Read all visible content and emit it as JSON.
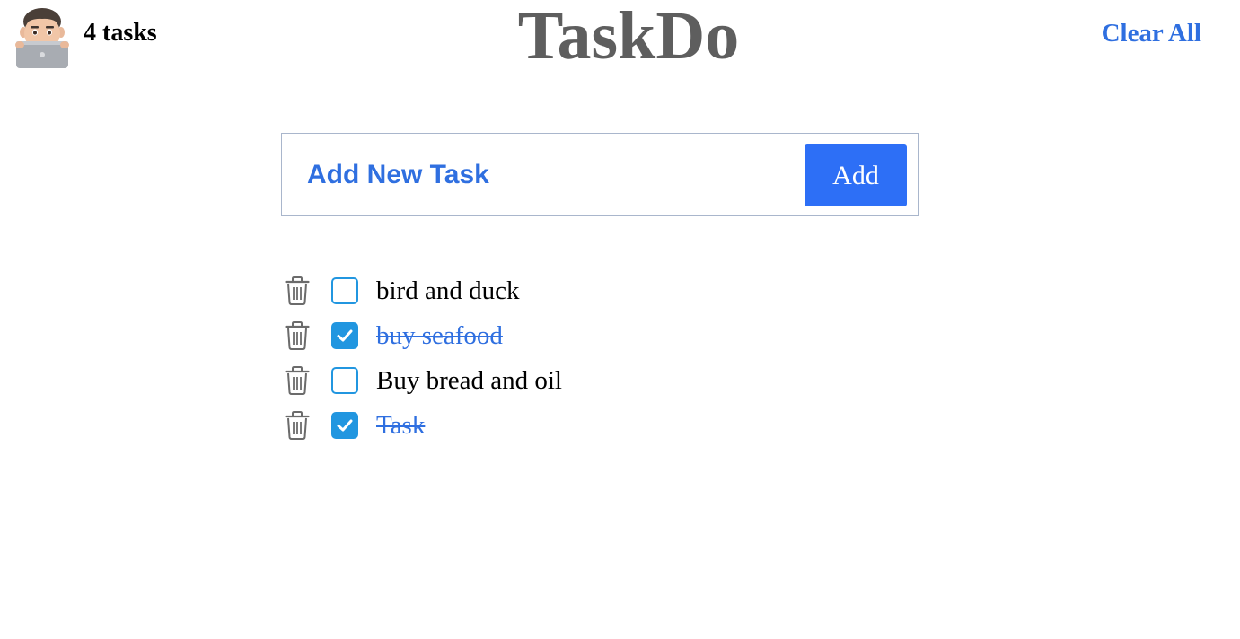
{
  "header": {
    "task_count_label": "4 tasks",
    "app_title": "TaskDo",
    "clear_all_label": "Clear All",
    "avatar_icon": "memoji-laptop-avatar"
  },
  "add_form": {
    "input_value": "",
    "input_placeholder": "Add New Task",
    "add_button_label": "Add"
  },
  "tasks": [
    {
      "text": "bird and duck",
      "completed": false
    },
    {
      "text": "buy seafood",
      "completed": true
    },
    {
      "text": "Buy bread and oil",
      "completed": false
    },
    {
      "text": "Task",
      "completed": true
    }
  ],
  "icons": {
    "delete": "trash-icon",
    "checked": "checkmark-icon"
  },
  "colors": {
    "accent": "#2f6fe0",
    "button": "#2d6ff6",
    "checkbox": "#2196e0",
    "title": "#5e5e5e"
  }
}
